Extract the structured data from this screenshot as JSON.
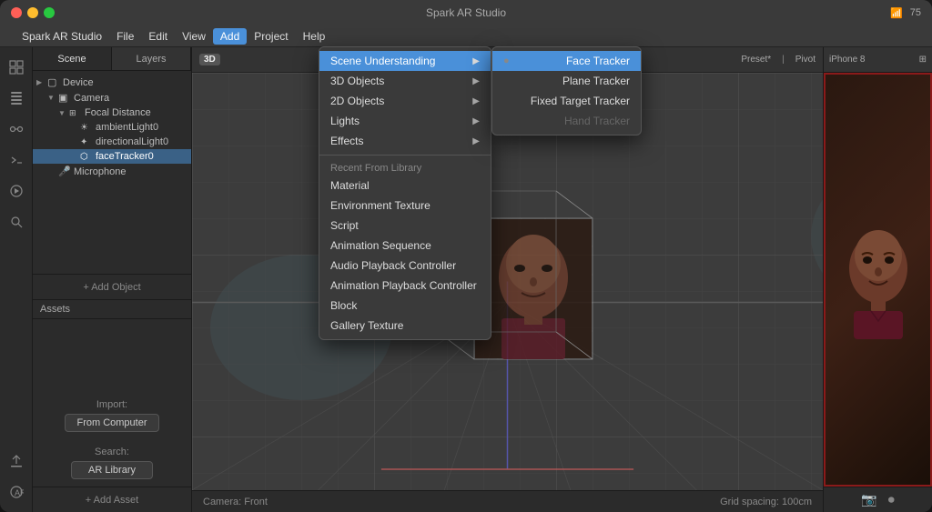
{
  "window": {
    "title": "Spark AR Studio"
  },
  "titlebar": {
    "title": "Spark AR Studio",
    "battery": "75"
  },
  "menubar": {
    "apple_logo": "",
    "items": [
      {
        "id": "spark",
        "label": "Spark AR Studio"
      },
      {
        "id": "file",
        "label": "File"
      },
      {
        "id": "edit",
        "label": "Edit"
      },
      {
        "id": "view",
        "label": "View"
      },
      {
        "id": "add",
        "label": "Add",
        "active": true
      },
      {
        "id": "project",
        "label": "Project"
      },
      {
        "id": "help",
        "label": "Help"
      }
    ]
  },
  "scene_panel": {
    "tabs": [
      {
        "id": "scene",
        "label": "Scene",
        "active": true
      },
      {
        "id": "layers",
        "label": "Layers"
      }
    ],
    "tree": [
      {
        "id": "device",
        "label": "Device",
        "level": 1,
        "icon": "▢",
        "arrow": "▶"
      },
      {
        "id": "camera",
        "label": "Camera",
        "level": 2,
        "icon": "▣",
        "arrow": "▼"
      },
      {
        "id": "focal",
        "label": "Focal Distance",
        "level": 3,
        "icon": "⊞",
        "arrow": "▼"
      },
      {
        "id": "ambient",
        "label": "ambientLight0",
        "level": 4,
        "icon": "☀",
        "arrow": ""
      },
      {
        "id": "directional",
        "label": "directionalLight0",
        "level": 4,
        "icon": "✦",
        "arrow": ""
      },
      {
        "id": "facetracker",
        "label": "faceTracker0",
        "level": 4,
        "icon": "⬡",
        "arrow": "",
        "selected": true
      },
      {
        "id": "microphone",
        "label": "Microphone",
        "level": 2,
        "icon": "♪",
        "arrow": ""
      }
    ],
    "add_object": "+ Add Object"
  },
  "assets_panel": {
    "title": "Assets",
    "import_label": "Import:",
    "import_btn": "From Computer",
    "search_label": "Search:",
    "search_btn": "AR Library",
    "add_asset": "+ Add Asset"
  },
  "viewport": {
    "badge_3d": "3D",
    "preset_label": "Preset*",
    "pivot_label": "Pivot",
    "device_label": "iPhone 8",
    "status_camera": "Camera: Front",
    "status_grid": "Grid spacing: 100cm"
  },
  "add_menu": {
    "items": [
      {
        "id": "scene_understanding",
        "label": "Scene Understanding",
        "arrow": "▶",
        "highlighted": true
      },
      {
        "id": "3d_objects",
        "label": "3D Objects",
        "arrow": "▶"
      },
      {
        "id": "2d_objects",
        "label": "2D Objects",
        "arrow": "▶"
      },
      {
        "id": "lights",
        "label": "Lights",
        "arrow": "▶"
      },
      {
        "id": "effects",
        "label": "Effects",
        "arrow": "▶"
      },
      {
        "divider": true
      },
      {
        "section": "Recent From Library"
      },
      {
        "id": "material",
        "label": "Material"
      },
      {
        "id": "env_texture",
        "label": "Environment Texture"
      },
      {
        "id": "script",
        "label": "Script"
      },
      {
        "id": "anim_seq",
        "label": "Animation Sequence"
      },
      {
        "id": "audio_playback",
        "label": "Audio Playback Controller"
      },
      {
        "id": "anim_playback",
        "label": "Animation Playback Controller"
      },
      {
        "id": "block",
        "label": "Block"
      },
      {
        "id": "gallery_texture",
        "label": "Gallery Texture"
      }
    ]
  },
  "scene_understanding_submenu": {
    "items": [
      {
        "id": "face_tracker",
        "label": "Face Tracker",
        "check": "●",
        "highlighted": true
      },
      {
        "id": "plane_tracker",
        "label": "Plane Tracker",
        "check": ""
      },
      {
        "id": "fixed_target",
        "label": "Fixed Target Tracker",
        "check": ""
      },
      {
        "id": "hand_tracker",
        "label": "Hand Tracker",
        "check": "",
        "disabled": true
      }
    ]
  },
  "sidebar_icons": {
    "top": [
      "⊞",
      "◫",
      "⊡",
      "⊕",
      "◉",
      "🔍"
    ],
    "bottom": [
      "↑",
      "⊙"
    ]
  }
}
